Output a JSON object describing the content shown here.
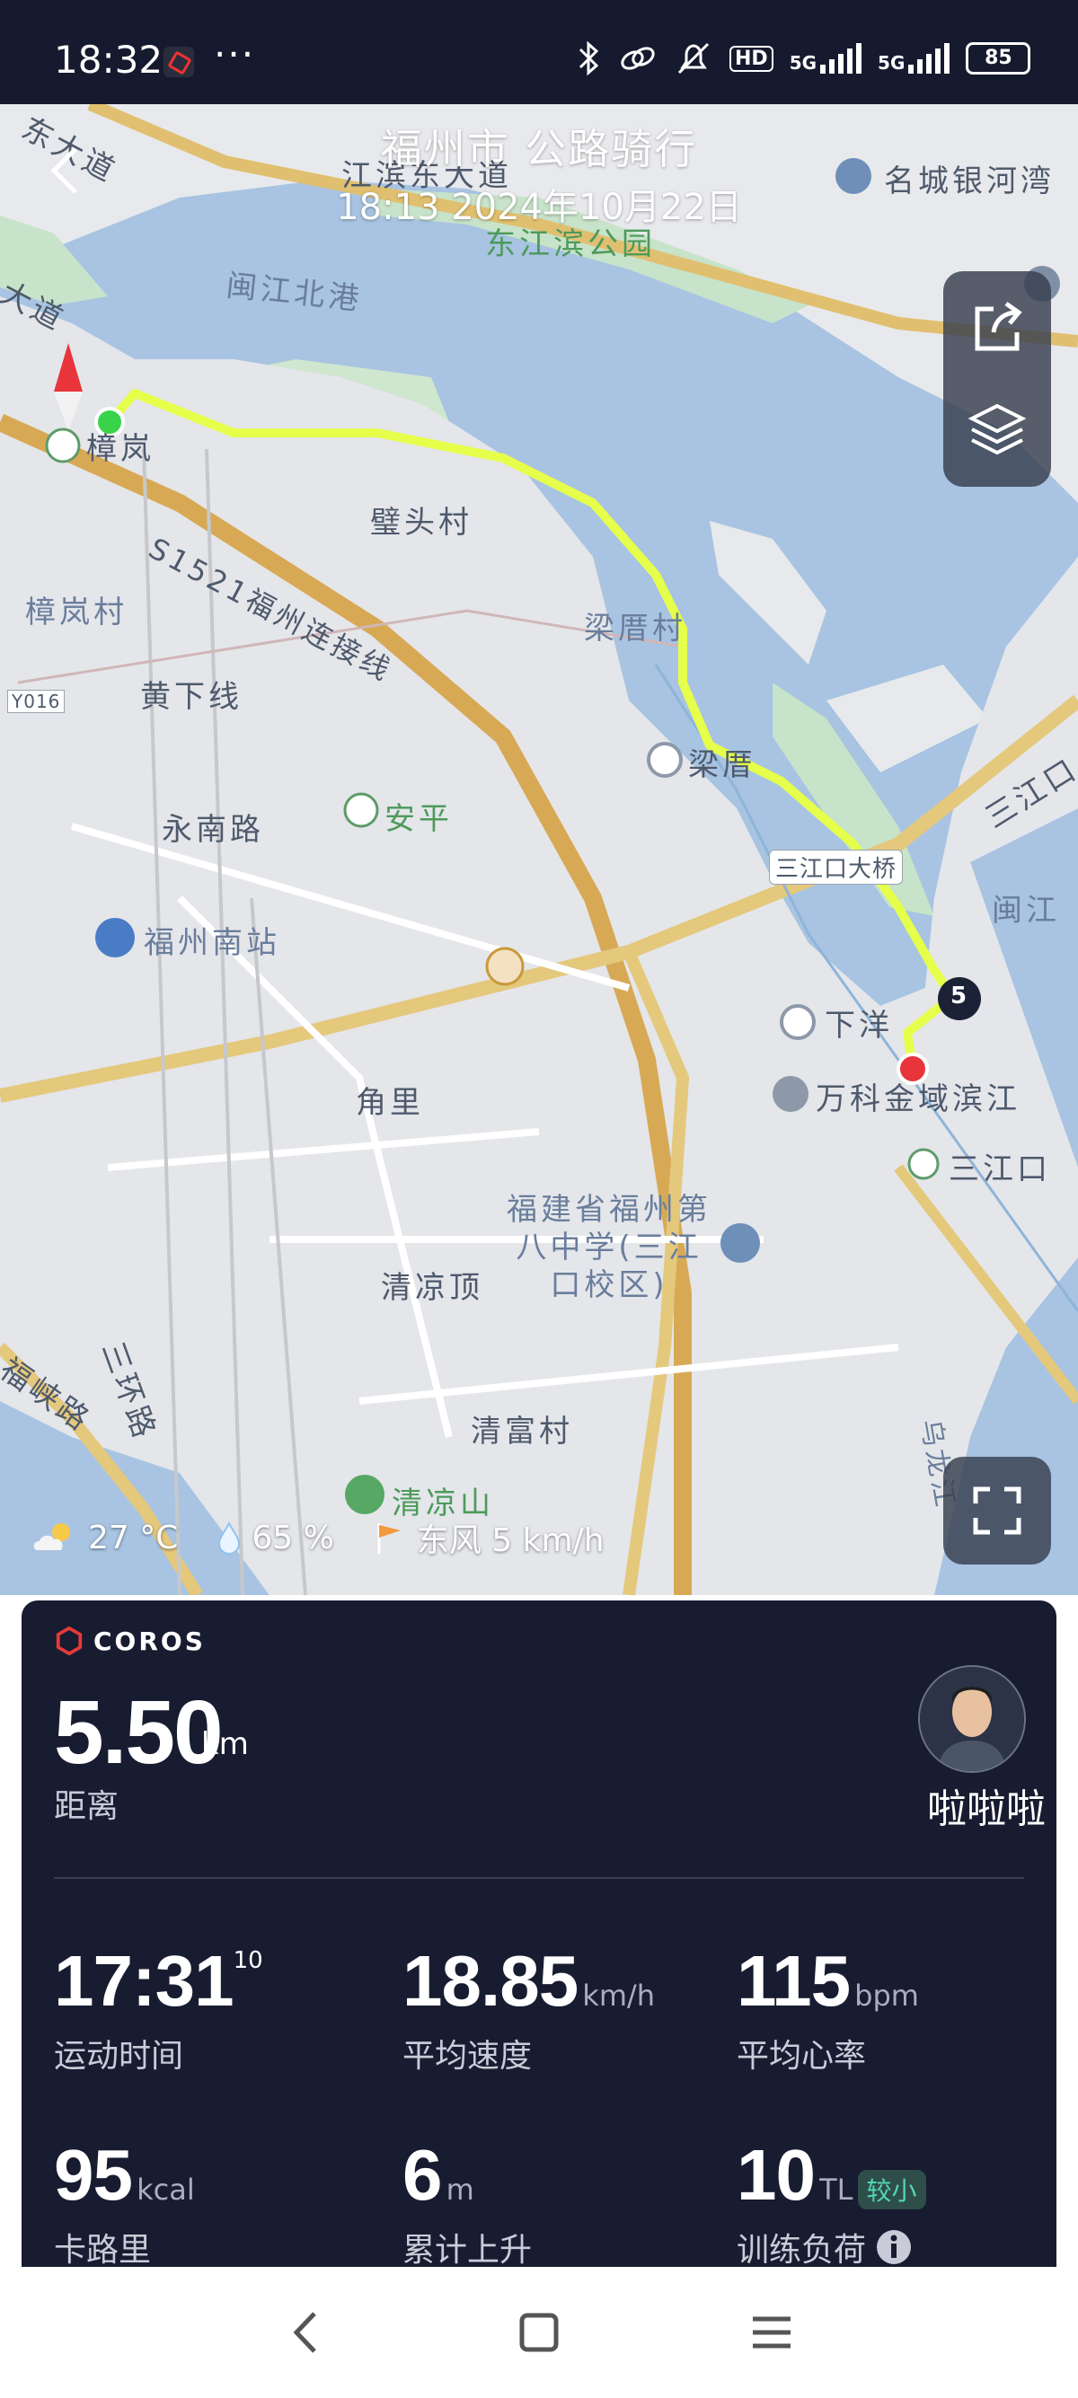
{
  "status_bar": {
    "time": "18:32",
    "more": "···",
    "battery": "85",
    "hd_badge": "HD",
    "net1": "5G",
    "net2": "5G",
    "icons": [
      "bluetooth-icon",
      "link-icon",
      "bell-off-icon",
      "hd-icon",
      "signal-icon",
      "signal-icon",
      "battery-icon"
    ]
  },
  "header": {
    "title": "福州市 公路骑行",
    "subtitle": "18:13 2024年10月22日"
  },
  "map": {
    "labels": [
      "东大道",
      "江滨东大道",
      "名城银河湾",
      "东江滨公园",
      "闽江北港",
      "大道",
      "樟岚",
      "璧头村",
      "S1521福州连接线",
      "樟岚村",
      "梁厝村",
      "黄下线",
      "Y016",
      "梁厝",
      "永南路",
      "安平",
      "三江口大桥",
      "福州南站",
      "闽江",
      "三江口",
      "下洋",
      "万科金域滨江",
      "三江口",
      "角里",
      "福建省福州第八中学(三江口校区)",
      "清凉顶",
      "清富村",
      "福峡路",
      "三环路",
      "清凉山",
      "乌龙江"
    ],
    "km_marker": "5"
  },
  "weather": {
    "temp": "27 °C",
    "humidity": "65  %",
    "wind": "东风 5 km/h"
  },
  "panel": {
    "brand": "COROS",
    "distance": "5.50",
    "distance_unit": "km",
    "distance_label": "距离",
    "username": "啦啦啦",
    "stats": [
      {
        "value": "17:31",
        "sup": "10",
        "unit": "",
        "label": "运动时间"
      },
      {
        "value": "18.85",
        "unit": "km/h",
        "label": "平均速度"
      },
      {
        "value": "115",
        "unit": "bpm",
        "label": "平均心率"
      },
      {
        "value": "95",
        "unit": "kcal",
        "label": "卡路里"
      },
      {
        "value": "6",
        "unit": "m",
        "label": "累计上升"
      },
      {
        "value": "10",
        "unit": "TL",
        "label": "训练负荷",
        "badge": "较小"
      }
    ]
  },
  "colors": {
    "route": "#e6ff4a",
    "start": "#39d34a",
    "end": "#e8353c",
    "panel_bg": "#181c30",
    "water": "#a8c4e2",
    "green_area": "#c7e3c9"
  }
}
